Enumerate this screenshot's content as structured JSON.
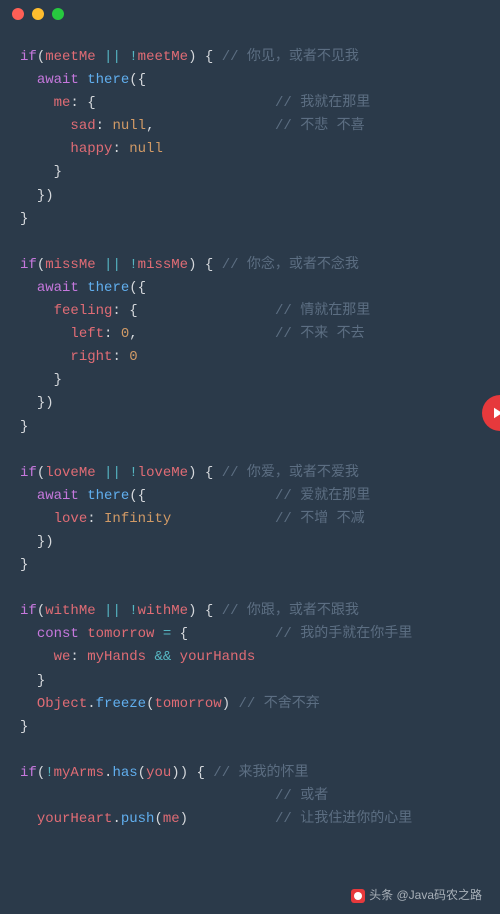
{
  "blocks": [
    {
      "cond": {
        "a": "meetMe",
        "b": "meetMe"
      },
      "cond_comment": "你见，或者不见我",
      "call": "there",
      "body_lines": [
        {
          "indent": 2,
          "text_parts": [
            [
              "prop",
              "me"
            ],
            [
              "punc",
              ": {"
            ]
          ],
          "comment": "我就在那里"
        },
        {
          "indent": 3,
          "text_parts": [
            [
              "prop",
              "sad"
            ],
            [
              "punc",
              ": "
            ],
            [
              "nul",
              "null"
            ],
            [
              "punc",
              ","
            ]
          ],
          "comment": "不悲 不喜"
        },
        {
          "indent": 3,
          "text_parts": [
            [
              "prop",
              "happy"
            ],
            [
              "punc",
              ": "
            ],
            [
              "nul",
              "null"
            ]
          ]
        },
        {
          "indent": 2,
          "text_parts": [
            [
              "punc",
              "}"
            ]
          ]
        }
      ],
      "close_call": true
    },
    {
      "cond": {
        "a": "missMe",
        "b": "missMe"
      },
      "cond_comment": "你念，或者不念我",
      "call": "there",
      "body_lines": [
        {
          "indent": 2,
          "text_parts": [
            [
              "prop",
              "feeling"
            ],
            [
              "punc",
              ": {"
            ]
          ],
          "comment": "情就在那里"
        },
        {
          "indent": 3,
          "text_parts": [
            [
              "prop",
              "left"
            ],
            [
              "punc",
              ": "
            ],
            [
              "num",
              "0"
            ],
            [
              "punc",
              ","
            ]
          ],
          "comment": "不来 不去"
        },
        {
          "indent": 3,
          "text_parts": [
            [
              "prop",
              "right"
            ],
            [
              "punc",
              ": "
            ],
            [
              "num",
              "0"
            ]
          ]
        },
        {
          "indent": 2,
          "text_parts": [
            [
              "punc",
              "}"
            ]
          ]
        }
      ],
      "close_call": true
    },
    {
      "cond": {
        "a": "loveMe",
        "b": "loveMe"
      },
      "cond_comment": "你爱，或者不爱我",
      "call": "there",
      "await_comment": "爱就在那里",
      "body_lines": [
        {
          "indent": 2,
          "text_parts": [
            [
              "prop",
              "love"
            ],
            [
              "punc",
              ": "
            ],
            [
              "inf",
              "Infinity"
            ]
          ],
          "comment": "不增 不减"
        }
      ],
      "close_call": true
    },
    {
      "cond": {
        "a": "withMe",
        "b": "withMe"
      },
      "cond_comment": "你跟，或者不跟我",
      "raw_lines": [
        {
          "indent": 1,
          "text_parts": [
            [
              "kw",
              "const"
            ],
            [
              "punc",
              " "
            ],
            [
              "id",
              "tomorrow"
            ],
            [
              "punc",
              " "
            ],
            [
              "op",
              "="
            ],
            [
              "punc",
              " {"
            ]
          ],
          "comment": "我的手就在你手里"
        },
        {
          "indent": 2,
          "text_parts": [
            [
              "prop",
              "we"
            ],
            [
              "punc",
              ": "
            ],
            [
              "id",
              "myHands"
            ],
            [
              "punc",
              " "
            ],
            [
              "op",
              "&&"
            ],
            [
              "punc",
              " "
            ],
            [
              "id",
              "yourHands"
            ]
          ]
        },
        {
          "indent": 1,
          "text_parts": [
            [
              "punc",
              "}"
            ]
          ]
        },
        {
          "indent": 1,
          "text_parts": [
            [
              "id",
              "Object"
            ],
            [
              "punc",
              "."
            ],
            [
              "fn",
              "freeze"
            ],
            [
              "punc",
              "("
            ],
            [
              "id",
              "tomorrow"
            ],
            [
              "punc",
              ") "
            ],
            [
              "cmt",
              "// 不舍不弃"
            ]
          ]
        }
      ]
    },
    {
      "cond_raw_parts": [
        [
          "kw",
          "if"
        ],
        [
          "punc",
          "("
        ],
        [
          "op",
          "!"
        ],
        [
          "id",
          "myArms"
        ],
        [
          "punc",
          "."
        ],
        [
          "fn",
          "has"
        ],
        [
          "punc",
          "("
        ],
        [
          "id",
          "you"
        ],
        [
          "punc",
          ")) {"
        ]
      ],
      "cond_comment": "来我的怀里",
      "raw_lines": [
        {
          "indent": 0,
          "text_parts": [],
          "comment": "或者"
        },
        {
          "indent": 1,
          "text_parts": [
            [
              "id",
              "yourHeart"
            ],
            [
              "punc",
              "."
            ],
            [
              "fn",
              "push"
            ],
            [
              "punc",
              "("
            ],
            [
              "id",
              "me"
            ],
            [
              "punc",
              ")"
            ]
          ],
          "comment": "让我住进你的心里"
        }
      ],
      "no_close": true
    }
  ],
  "watermark": "头条 @Java码农之路"
}
